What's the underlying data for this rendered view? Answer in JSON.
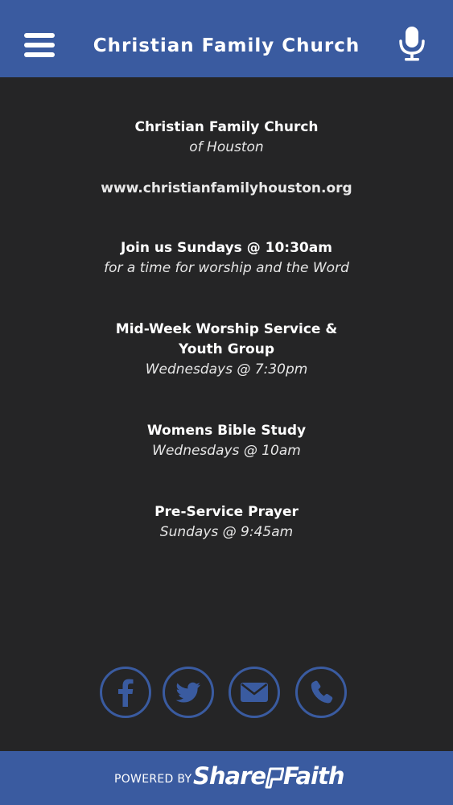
{
  "header": {
    "title": "Christian Family Church",
    "menu_icon": "hamburger-menu-icon",
    "mic_icon": "microphone-icon"
  },
  "content": {
    "church": {
      "name": "Christian Family Church",
      "location": "of Houston"
    },
    "website": "www.christianfamilyhouston.org",
    "sections": [
      {
        "title_lines": [
          "Join us Sundays @ 10:30am"
        ],
        "subtitle": "for a time for worship and the Word"
      },
      {
        "title_lines": [
          "Mid-Week Worship Service &",
          "Youth Group"
        ],
        "subtitle": "Wednesdays @ 7:30pm"
      },
      {
        "title_lines": [
          "Womens Bible Study"
        ],
        "subtitle": "Wednesdays @ 10am"
      },
      {
        "title_lines": [
          "Pre-Service Prayer"
        ],
        "subtitle": "Sundays @ 9:45am"
      }
    ]
  },
  "social": [
    {
      "icon": "facebook-icon"
    },
    {
      "icon": "twitter-icon"
    },
    {
      "icon": "email-icon"
    },
    {
      "icon": "phone-icon"
    }
  ],
  "footer": {
    "powered_by": "POWERED BY",
    "brand_part1": "Share",
    "brand_part2": "Faith"
  },
  "colors": {
    "header_bg": "#3a5ba0",
    "page_bg": "#252526",
    "icon_accent": "#3a5ba0",
    "text": "#ffffff"
  }
}
